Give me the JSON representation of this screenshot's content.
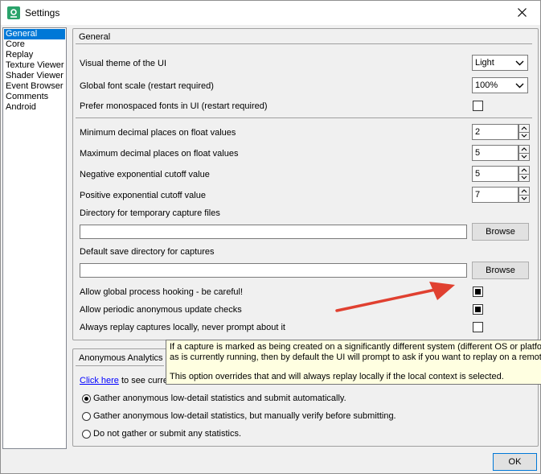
{
  "window": {
    "title": "Settings"
  },
  "sidebar": {
    "items": [
      "General",
      "Core",
      "Replay",
      "Texture Viewer",
      "Shader Viewer",
      "Event Browser",
      "Comments",
      "Android"
    ]
  },
  "general": {
    "title": "General",
    "theme_label": "Visual theme of the UI",
    "theme_value": "Light",
    "font_scale_label": "Global font scale (restart required)",
    "font_scale_value": "100%",
    "mono_label": "Prefer monospaced fonts in UI (restart required)",
    "min_decimal_label": "Minimum decimal places on float values",
    "min_decimal_value": "2",
    "max_decimal_label": "Maximum decimal places on float values",
    "max_decimal_value": "5",
    "neg_exp_label": "Negative exponential cutoff value",
    "neg_exp_value": "5",
    "pos_exp_label": "Positive exponential cutoff value",
    "pos_exp_value": "7",
    "temp_dir_label": "Directory for temporary capture files",
    "save_dir_label": "Default save directory for captures",
    "browse_label": "Browse",
    "hooking_label": "Allow global process hooking - be careful!",
    "update_label": "Allow periodic anonymous update checks",
    "replay_local_label": "Always replay captures locally, never prompt about it"
  },
  "analytics": {
    "title": "Anonymous Analytics",
    "link": "Click here",
    "link_suffix": " to see curre",
    "options": [
      "Gather anonymous low-detail statistics and submit automatically.",
      "Gather anonymous low-detail statistics, but manually verify before submitting.",
      "Do not gather or submit any statistics."
    ]
  },
  "tooltip": {
    "line1": "If a capture is marked as being created on a significantly different system (different OS or platfor",
    "line2": "as is currently running, then by default the UI will prompt to ask if you want to replay on a remot",
    "line3": "This option overrides that and will always replay locally if the local context is selected."
  },
  "footer": {
    "ok_label": "OK"
  },
  "colors": {
    "selection": "#0078d7",
    "arrow": "#e04030",
    "tooltip_bg": "#ffffe1",
    "link": "#0000ff",
    "app_icon": "#2aa36b"
  },
  "icons": {
    "app": "renderdoc-icon",
    "close": "close-icon"
  }
}
